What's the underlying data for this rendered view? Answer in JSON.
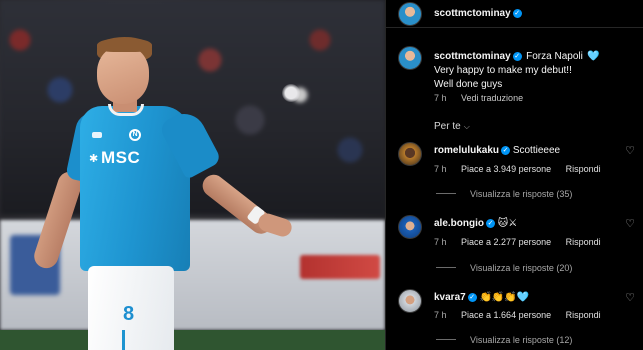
{
  "post": {
    "author": "scottmctominay",
    "caption_lead": "Forza Napoli",
    "caption_emoji": "🩵",
    "caption_lines": [
      "Very happy to make my debut!!",
      "Well done guys"
    ],
    "time": "7 h",
    "translate": "Vedi traduzione"
  },
  "photo": {
    "sponsor": "MSC",
    "shirt_number": "8"
  },
  "filter": {
    "label": "Per te",
    "chevron": "⌵"
  },
  "comments": [
    {
      "username": "romelulukaku",
      "text": "Scottieeee",
      "time": "7 h",
      "likes": "Piace a 3.949 persone",
      "reply": "Rispondi",
      "view_replies": "Visualizza le risposte (35)"
    },
    {
      "username": "ale.bongio",
      "text": "🐱⚔",
      "time": "7 h",
      "likes": "Piace a 2.277 persone",
      "reply": "Rispondi",
      "view_replies": "Visualizza le risposte (20)"
    },
    {
      "username": "kvara7",
      "text": "👏👏👏🩵",
      "time": "7 h",
      "likes": "Piace a 1.664 persone",
      "reply": "Rispondi",
      "view_replies": "Visualizza le risposte (12)"
    }
  ],
  "icons": {
    "verified": "✓",
    "heart": "♡"
  },
  "colors": {
    "verified_blue": "#0095f6",
    "napoli_blue": "#1e94d0"
  }
}
